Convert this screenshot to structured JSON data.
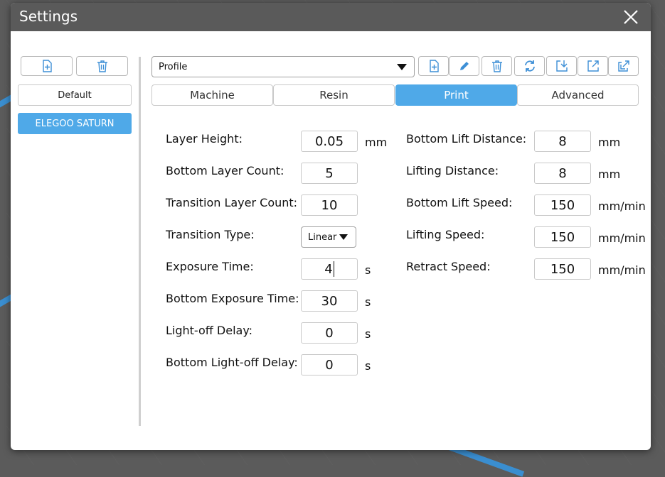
{
  "window": {
    "title": "Settings"
  },
  "sidebar": {
    "new_icon": "file-plus-icon",
    "delete_icon": "trash-icon",
    "items": [
      {
        "label": "Default",
        "selected": false
      },
      {
        "label": "ELEGOO SATURN",
        "selected": true
      }
    ]
  },
  "toolbar": {
    "profile_select": {
      "value": "Profile"
    },
    "icons": [
      "file-plus-icon",
      "pencil-icon",
      "trash-icon",
      "refresh-icon",
      "import-icon",
      "export-icon",
      "export-copy-icon"
    ]
  },
  "tabs": [
    {
      "label": "Machine",
      "active": false
    },
    {
      "label": "Resin",
      "active": false
    },
    {
      "label": "Print",
      "active": true
    },
    {
      "label": "Advanced",
      "active": false
    }
  ],
  "print": {
    "left": [
      {
        "label": "Layer Height:",
        "value": "0.05",
        "unit": "mm"
      },
      {
        "label": "Bottom Layer Count:",
        "value": "5",
        "unit": ""
      },
      {
        "label": "Transition Layer Count:",
        "value": "10",
        "unit": ""
      },
      {
        "label": "Transition Type:",
        "value": "Linear",
        "unit": ""
      },
      {
        "label": "Exposure Time:",
        "value": "4",
        "unit": "s"
      },
      {
        "label": "Bottom Exposure Time:",
        "value": "30",
        "unit": "s"
      },
      {
        "label": "Light-off Delay:",
        "value": "0",
        "unit": "s"
      },
      {
        "label": "Bottom Light-off Delay:",
        "value": "0",
        "unit": "s"
      }
    ],
    "right": [
      {
        "label": "Bottom Lift Distance:",
        "value": "8",
        "unit": "mm"
      },
      {
        "label": "Lifting Distance:",
        "value": "8",
        "unit": "mm"
      },
      {
        "label": "Bottom Lift Speed:",
        "value": "150",
        "unit": "mm/min"
      },
      {
        "label": "Lifting Speed:",
        "value": "150",
        "unit": "mm/min"
      },
      {
        "label": "Retract Speed:",
        "value": "150",
        "unit": "mm/min"
      }
    ]
  },
  "colors": {
    "accent": "#4fa9e8",
    "titlebar": "#5a5a5a",
    "icon_blue": "#3d8fd6"
  }
}
